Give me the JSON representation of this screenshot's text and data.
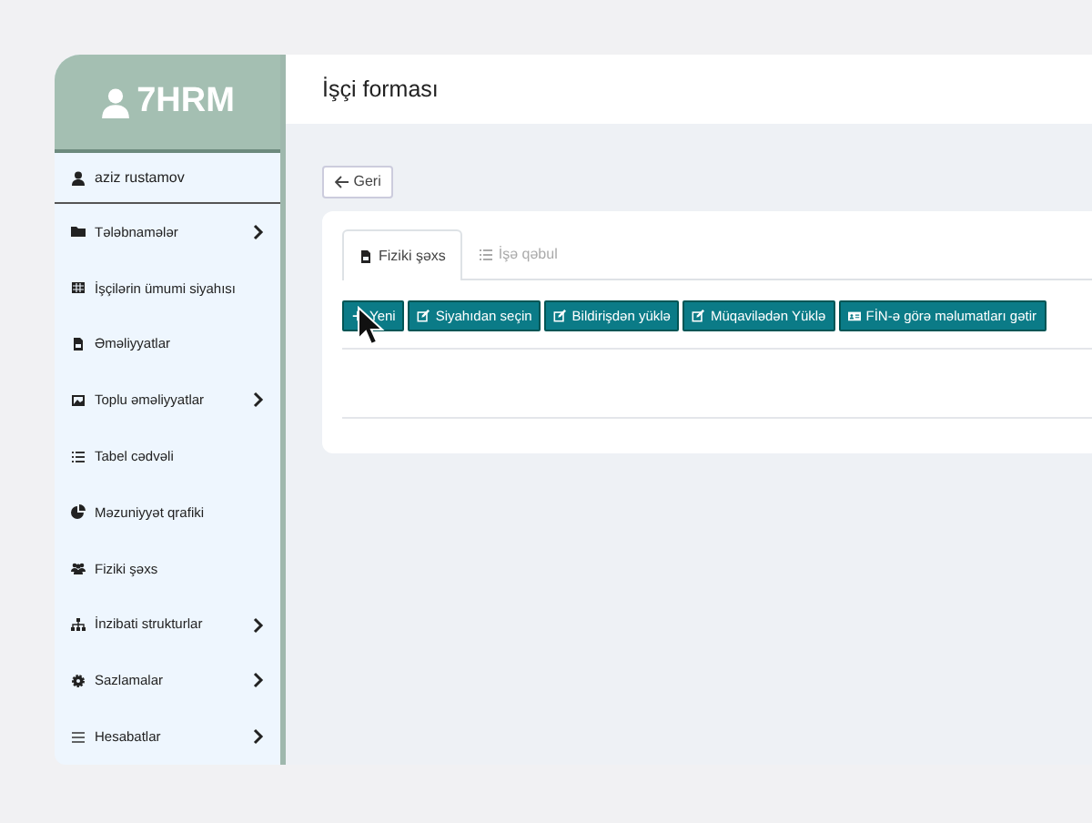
{
  "logo": {
    "text": "7HRM"
  },
  "user": {
    "name": "aziz rustamov"
  },
  "sidebar": {
    "items": [
      {
        "label": "Tələbnamələr",
        "expandable": true
      },
      {
        "label": "İşçilərin ümumi siyahısı",
        "expandable": false
      },
      {
        "label": "Əməliyyatlar",
        "expandable": false
      },
      {
        "label": "Toplu əməliyyatlar",
        "expandable": true
      },
      {
        "label": "Tabel cədvəli",
        "expandable": false
      },
      {
        "label": "Məzuniyyət qrafiki",
        "expandable": false
      },
      {
        "label": "Fiziki şəxs",
        "expandable": false
      },
      {
        "label": "İnzibati strukturlar",
        "expandable": true
      },
      {
        "label": "Sazlamalar",
        "expandable": true
      },
      {
        "label": "Hesabatlar",
        "expandable": true
      }
    ]
  },
  "page": {
    "title": "İşçi forması",
    "back_button": "Geri"
  },
  "tabs": [
    {
      "label": "Fiziki şəxs",
      "selected": true
    },
    {
      "label": "İşə qəbul",
      "selected": false
    }
  ],
  "actions": [
    {
      "label": "Yeni"
    },
    {
      "label": "Siyahıdan seçin"
    },
    {
      "label": "Bildirişdən yüklə"
    },
    {
      "label": "Müqavilədən Yüklə"
    },
    {
      "label": "FİN-ə görə məlumatları gətir"
    }
  ]
}
